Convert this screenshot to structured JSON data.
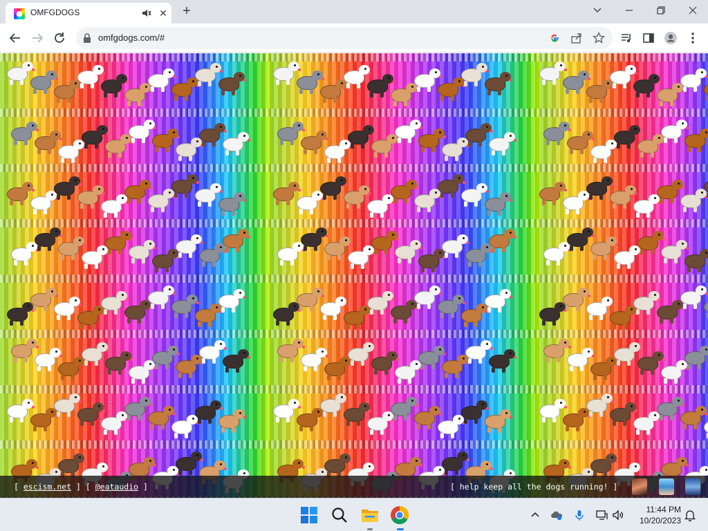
{
  "browser": {
    "tab": {
      "title": "OMFGDOGS",
      "favicon": "rainbow-dog-favicon",
      "audio_icon": "speaker-icon",
      "close_icon": "close-icon"
    },
    "new_tab_icon": "plus-icon",
    "window_controls": [
      "chevron-down-icon",
      "minimize-icon",
      "restore-icon",
      "close-icon"
    ],
    "toolbar": {
      "back_icon": "back-arrow-icon",
      "forward_icon": "forward-arrow-icon",
      "reload_icon": "reload-icon",
      "url": "omfgdogs.com/#",
      "omnibox_icons": [
        "google-icon",
        "share-icon",
        "star-icon"
      ],
      "right_icons": [
        "media-queue-icon",
        "side-panel-icon",
        "profile-icon",
        "more-vert-icon"
      ]
    }
  },
  "page": {
    "background": "tiled rainbow running dogs",
    "footer": {
      "open_bracket_1": "[ ",
      "link_1": "escism.net",
      "mid_text": " ] [ ",
      "link_2": "@eataudio",
      "close_bracket_2": " ]",
      "right_text": "[ help keep all the dogs running! ]"
    }
  },
  "taskbar": {
    "apps": [
      "windows-start-icon",
      "search-icon",
      "file-explorer-icon",
      "chrome-icon"
    ],
    "tray_icons": [
      "chevron-up-icon",
      "onedrive-icon",
      "microphone-icon",
      "network-icon",
      "volume-icon"
    ],
    "time": "11:44 PM",
    "date": "10/20/2023",
    "notification_icon": "bell-icon"
  },
  "colors": {
    "tabstrip": "#dee1e6",
    "omnibox": "#f1f3f4",
    "footer_bg": "#141414",
    "taskbar": "#e6ebf2"
  }
}
